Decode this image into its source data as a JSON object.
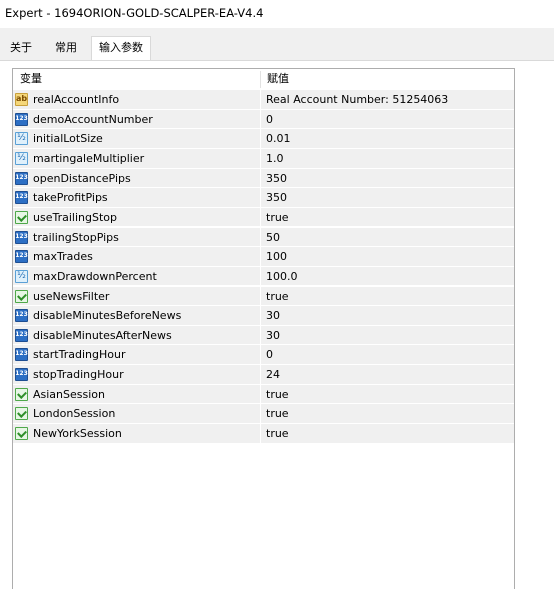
{
  "window": {
    "title": "Expert - 1694ORION-GOLD-SCALPER-EA-V4.4"
  },
  "tabs": [
    {
      "label": "关于",
      "active": false
    },
    {
      "label": "常用",
      "active": false
    },
    {
      "label": "输入参数",
      "active": true
    }
  ],
  "table": {
    "headers": {
      "variable": "变量",
      "value": "赋值"
    },
    "rows": [
      {
        "icon": "string-type-icon",
        "name": "realAccountInfo",
        "value": "Real Account Number: 51254063"
      },
      {
        "icon": "integer-type-icon",
        "name": "demoAccountNumber",
        "value": "0"
      },
      {
        "icon": "double-type-icon",
        "name": "initialLotSize",
        "value": "0.01"
      },
      {
        "icon": "double-type-icon",
        "name": "martingaleMultiplier",
        "value": "1.0"
      },
      {
        "icon": "integer-type-icon",
        "name": "openDistancePips",
        "value": "350"
      },
      {
        "icon": "integer-type-icon",
        "name": "takeProfitPips",
        "value": "350"
      },
      {
        "icon": "bool-type-icon",
        "name": "useTrailingStop",
        "value": "true"
      },
      {
        "icon": "integer-type-icon",
        "name": "trailingStopPips",
        "value": "50"
      },
      {
        "icon": "integer-type-icon",
        "name": "maxTrades",
        "value": "100"
      },
      {
        "icon": "double-type-icon",
        "name": "maxDrawdownPercent",
        "value": "100.0"
      },
      {
        "icon": "bool-type-icon",
        "name": "useNewsFilter",
        "value": "true"
      },
      {
        "icon": "integer-type-icon",
        "name": "disableMinutesBeforeNews",
        "value": "30"
      },
      {
        "icon": "integer-type-icon",
        "name": "disableMinutesAfterNews",
        "value": "30"
      },
      {
        "icon": "integer-type-icon",
        "name": "startTradingHour",
        "value": "0"
      },
      {
        "icon": "integer-type-icon",
        "name": "stopTradingHour",
        "value": "24"
      },
      {
        "icon": "bool-type-icon",
        "name": "AsianSession",
        "value": "true"
      },
      {
        "icon": "bool-type-icon",
        "name": "LondonSession",
        "value": "true"
      },
      {
        "icon": "bool-type-icon",
        "name": "NewYorkSession",
        "value": "true"
      }
    ]
  }
}
